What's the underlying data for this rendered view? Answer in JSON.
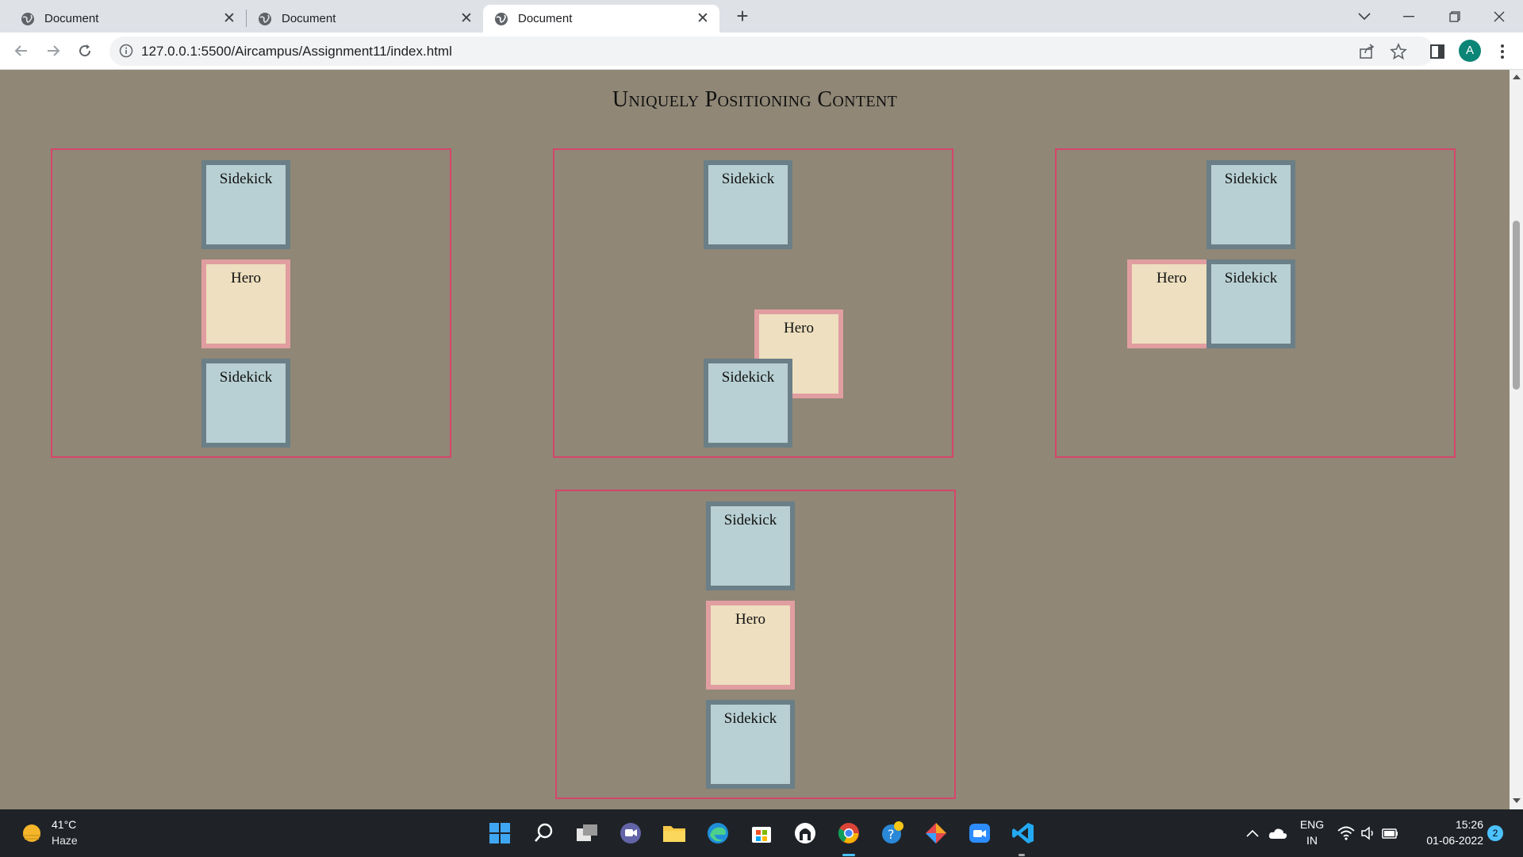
{
  "browser": {
    "tabs": [
      {
        "title": "Document",
        "active": false
      },
      {
        "title": "Document",
        "active": false
      },
      {
        "title": "Document",
        "active": true
      }
    ],
    "url": "127.0.0.1:5500/Aircampus/Assignment11/index.html",
    "profile_initial": "A"
  },
  "page": {
    "heading": "Uniquely Positioning Content",
    "frames": [
      {
        "boxes": [
          {
            "type": "sidekick",
            "label": "Sidekick"
          },
          {
            "type": "hero",
            "label": "Hero"
          },
          {
            "type": "sidekick",
            "label": "Sidekick"
          }
        ]
      },
      {
        "boxes": [
          {
            "type": "sidekick",
            "label": "Sidekick"
          },
          {
            "type": "hero",
            "label": "Hero"
          },
          {
            "type": "sidekick",
            "label": "Sidekick"
          }
        ]
      },
      {
        "boxes": [
          {
            "type": "sidekick",
            "label": "Sidekick"
          },
          {
            "type": "hero",
            "label": "Hero"
          },
          {
            "type": "sidekick",
            "label": "Sidekick"
          }
        ]
      },
      {
        "boxes": [
          {
            "type": "sidekick",
            "label": "Sidekick"
          },
          {
            "type": "hero",
            "label": "Hero"
          },
          {
            "type": "sidekick",
            "label": "Sidekick"
          }
        ]
      }
    ]
  },
  "taskbar": {
    "weather_temp": "41°C",
    "weather_desc": "Haze",
    "lang_line1": "ENG",
    "lang_line2": "IN",
    "time": "15:26",
    "date": "01-06-2022",
    "notifications": "2"
  },
  "colors": {
    "page_bg": "#908776",
    "frame_border": "#d6456b",
    "sidekick_fill": "#b8d0d3",
    "sidekick_border": "#6a7f87",
    "hero_fill": "#eddfbf",
    "hero_border": "#e19ea1"
  }
}
